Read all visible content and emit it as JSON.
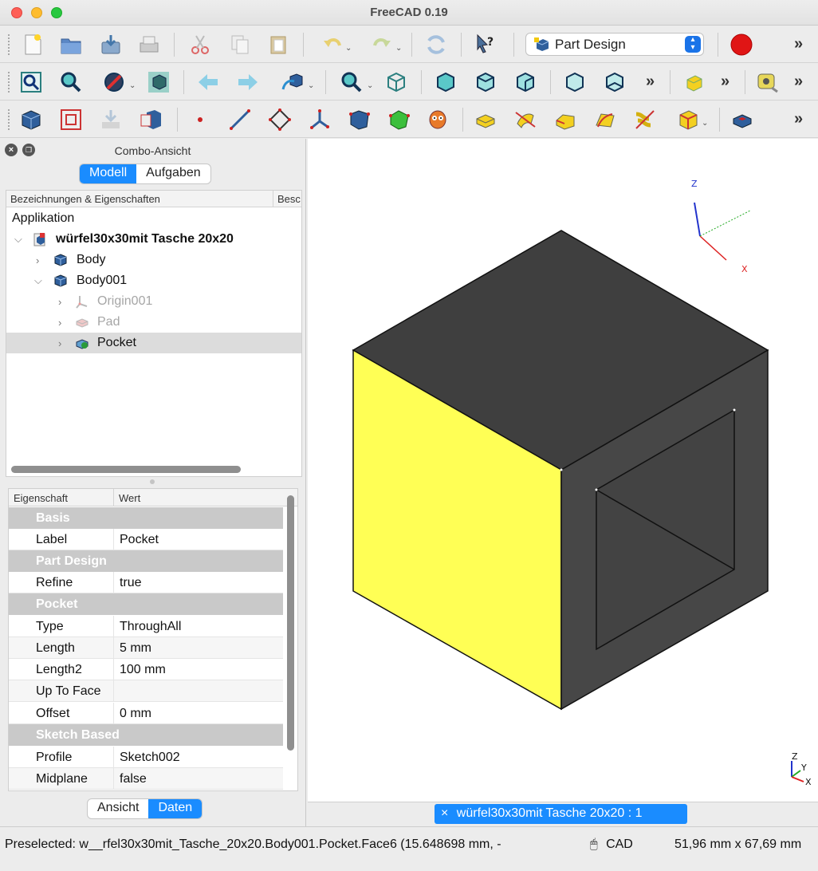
{
  "window": {
    "title": "FreeCAD 0.19"
  },
  "toolbar": {
    "workbench_label": "Part Design",
    "overflow_glyph": "»"
  },
  "combo": {
    "title": "Combo-Ansicht",
    "tabs": {
      "model": "Modell",
      "tasks": "Aufgaben"
    },
    "tree": {
      "col_label": "Bezeichnungen & Eigenschaften",
      "col_desc": "Besc",
      "root": "Applikation",
      "document": "würfel30x30mit Tasche 20x20",
      "items": [
        "Body",
        "Body001",
        "Origin001",
        "Pad",
        "Pocket"
      ]
    },
    "properties": {
      "col_property": "Eigenschaft",
      "col_value": "Wert",
      "groups": {
        "basis": "Basis",
        "part_design": "Part Design",
        "pocket": "Pocket",
        "sketch_based": "Sketch Based"
      },
      "rows": {
        "label": {
          "k": "Label",
          "v": "Pocket"
        },
        "refine": {
          "k": "Refine",
          "v": "true"
        },
        "type": {
          "k": "Type",
          "v": "ThroughAll"
        },
        "length": {
          "k": "Length",
          "v": "5 mm"
        },
        "length2": {
          "k": "Length2",
          "v": "100 mm"
        },
        "uptoface": {
          "k": "Up To Face",
          "v": ""
        },
        "offset": {
          "k": "Offset",
          "v": "0 mm"
        },
        "profile": {
          "k": "Profile",
          "v": "Sketch002"
        },
        "midplane": {
          "k": "Midplane",
          "v": "false"
        }
      }
    },
    "bottom_tabs": {
      "view": "Ansicht",
      "data": "Daten"
    }
  },
  "view": {
    "axis_labels": {
      "z": "Z",
      "x": "X",
      "y": "Y"
    },
    "doc_tab": "würfel30x30mit Tasche 20x20 : 1",
    "doc_tab_close": "×",
    "colors": {
      "selected_face": "#ffff55",
      "body": "#444444",
      "top": "#3f3f3f"
    }
  },
  "status": {
    "message": "Preselected: w__rfel30x30mit_Tasche_20x20.Body001.Pocket.Face6 (15.648698 mm, -",
    "nav_style": "CAD",
    "dimensions": "51,96 mm x 67,69 mm"
  }
}
